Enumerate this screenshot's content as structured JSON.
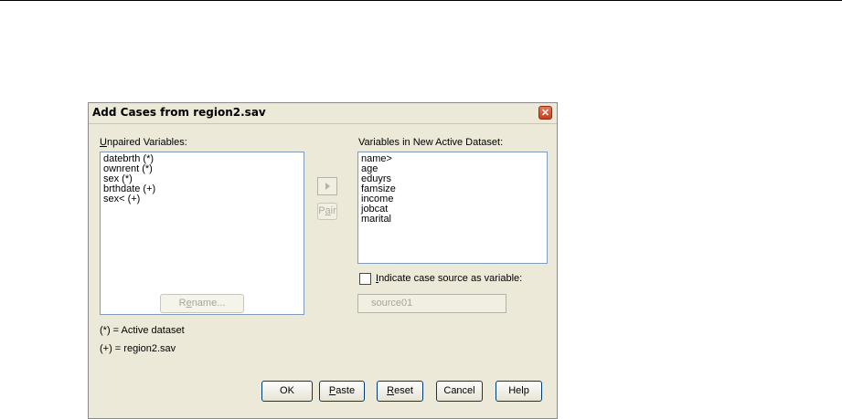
{
  "dialog": {
    "title": "Add Cases from region2.sav",
    "close_glyph": "✕",
    "unpaired": {
      "label_accel": "U",
      "label_rest": "npaired Variables:",
      "items": [
        "datebrth (*)",
        "ownrent (*)",
        "sex (*)",
        "brthdate (+)",
        "sex< (+)"
      ]
    },
    "new_dataset": {
      "label": "Variables in New Active Dataset:",
      "items": [
        "name>",
        "age",
        "eduyrs",
        "famsize",
        "income",
        "jobcat",
        "marital"
      ]
    },
    "pair_button": {
      "pre": "P",
      "accel": "a",
      "post": "ir"
    },
    "rename_button": {
      "pre": "R",
      "accel": "e",
      "post": "name..."
    },
    "legend": {
      "active": "(*) = Active dataset",
      "region": "(+) = region2.sav"
    },
    "indicate_source": {
      "accel": "I",
      "rest": "ndicate case source as variable:",
      "checked": false,
      "value": "source01"
    },
    "buttons": {
      "ok": "OK",
      "paste": {
        "accel": "P",
        "rest": "aste"
      },
      "reset": {
        "accel": "R",
        "rest": "eset"
      },
      "cancel": "Cancel",
      "help": "Help"
    }
  }
}
